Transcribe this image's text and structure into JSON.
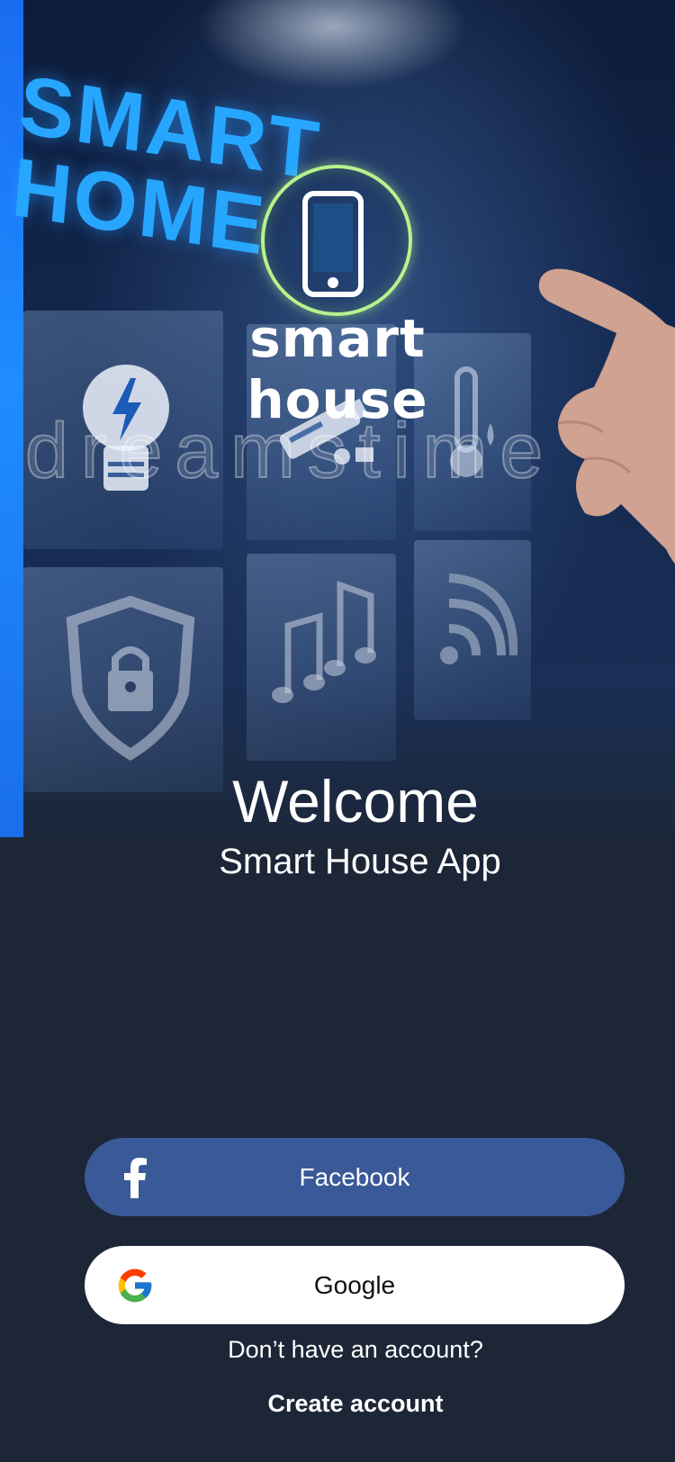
{
  "hero": {
    "banner_text": "SMART HOME",
    "logo_text": "smart house",
    "watermark": "dreamstime",
    "icons": [
      "lightbulb-icon",
      "security-camera-icon",
      "thermometer-icon",
      "shield-lock-icon",
      "music-note-icon",
      "wifi-icon",
      "smartphone-icon"
    ]
  },
  "welcome": {
    "title": "Welcome",
    "subtitle": "Smart House App"
  },
  "auth": {
    "facebook_label": "Facebook",
    "google_label": "Google",
    "no_account_text": "Don’t have an account?",
    "create_account_label": "Create account"
  },
  "colors": {
    "background": "#1c2637",
    "facebook": "#3a5998",
    "google_button": "#ffffff",
    "accent_blue": "#27a6ff",
    "logo_ring": "#b6f38c"
  }
}
